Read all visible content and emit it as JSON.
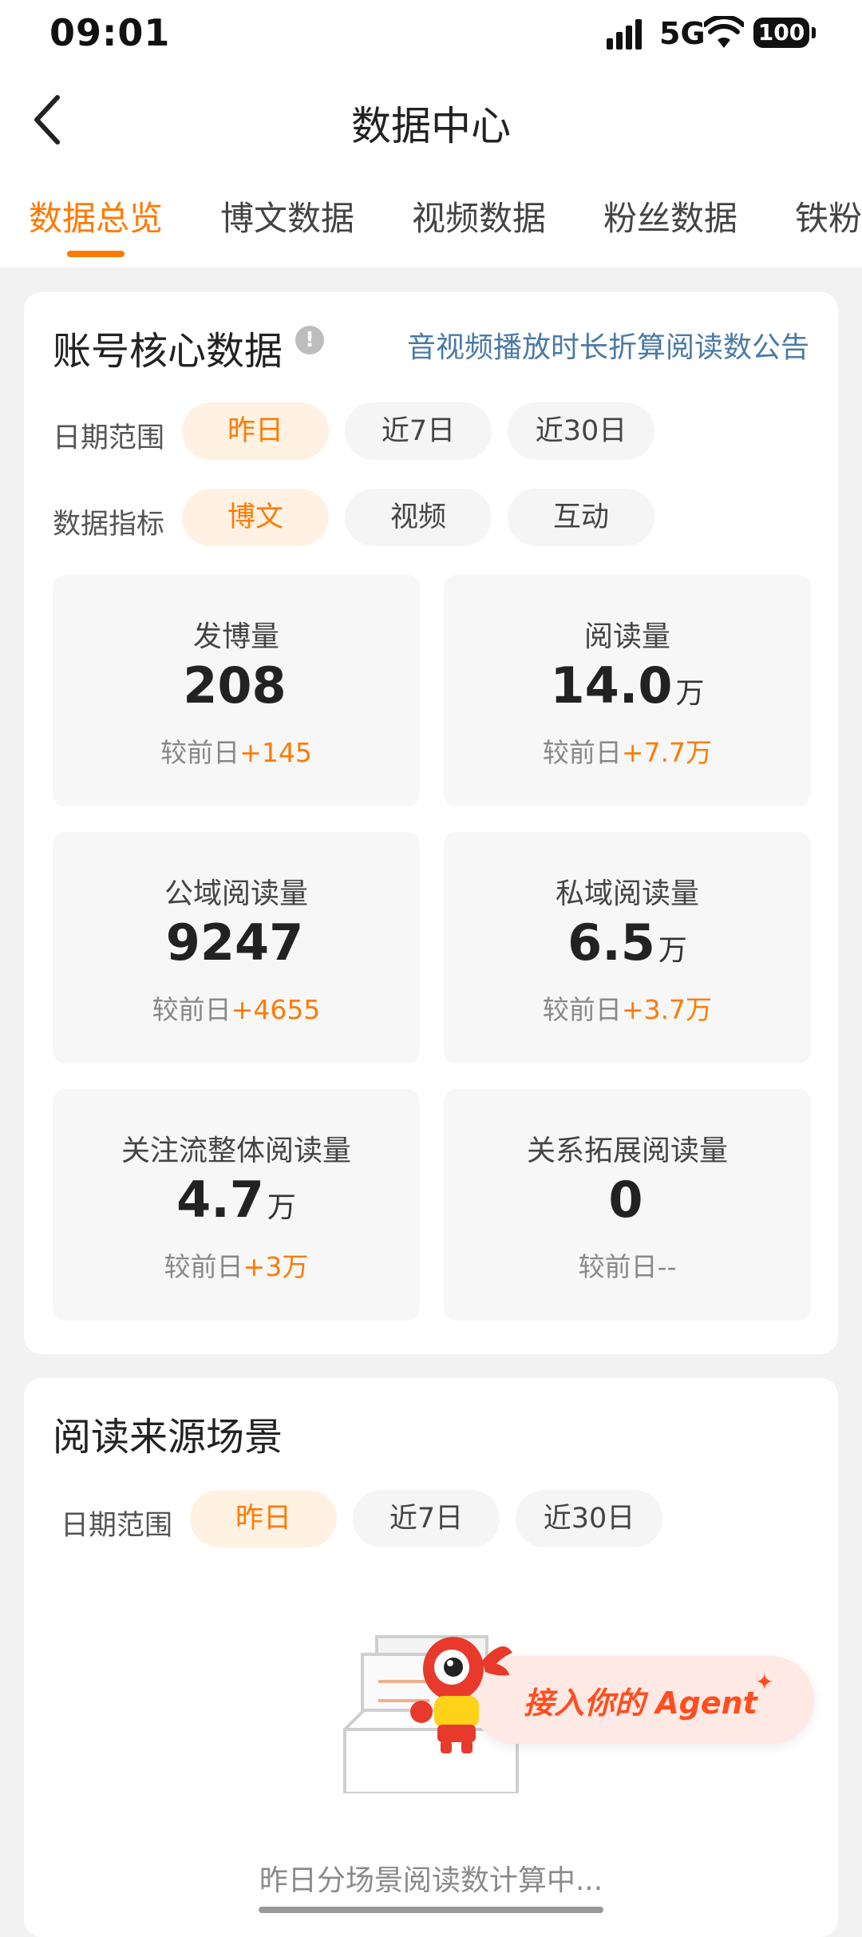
{
  "status_bar": {
    "time": "09:01",
    "network": "5G",
    "battery": "100"
  },
  "header": {
    "title": "数据中心"
  },
  "tabs": [
    {
      "label": "数据总览",
      "active": true
    },
    {
      "label": "博文数据",
      "active": false
    },
    {
      "label": "视频数据",
      "active": false
    },
    {
      "label": "粉丝数据",
      "active": false
    },
    {
      "label": "铁粉",
      "active": false
    }
  ],
  "core": {
    "title": "账号核心数据",
    "notice_link": "音视频播放时长折算阅读数公告",
    "date_label": "日期范围",
    "date_options": [
      "昨日",
      "近7日",
      "近30日"
    ],
    "date_selected": "昨日",
    "metric_label": "数据指标",
    "metric_options": [
      "博文",
      "视频",
      "互动"
    ],
    "metric_selected": "博文",
    "stats": [
      {
        "label": "发博量",
        "value": "208",
        "unit": "",
        "compare_prefix": "较前日",
        "compare_value": "+145"
      },
      {
        "label": "阅读量",
        "value": "14.0",
        "unit": "万",
        "compare_prefix": "较前日",
        "compare_value": "+7.7万"
      },
      {
        "label": "公域阅读量",
        "value": "9247",
        "unit": "",
        "compare_prefix": "较前日",
        "compare_value": "+4655"
      },
      {
        "label": "私域阅读量",
        "value": "6.5",
        "unit": "万",
        "compare_prefix": "较前日",
        "compare_value": "+3.7万"
      },
      {
        "label": "关注流整体阅读量",
        "value": "4.7",
        "unit": "万",
        "compare_prefix": "较前日",
        "compare_value": "+3万"
      },
      {
        "label": "关系拓展阅读量",
        "value": "0",
        "unit": "",
        "compare_prefix": "较前日",
        "compare_value": "--"
      }
    ]
  },
  "source": {
    "title": "阅读来源场景",
    "date_label": "日期范围",
    "date_options": [
      "昨日",
      "近7日",
      "近30日"
    ],
    "date_selected": "昨日",
    "loading_text": "昨日分场景阅读数计算中..."
  },
  "agent_banner": {
    "text": "接入你的 Agent",
    "spark": "✦"
  },
  "colors": {
    "accent": "#ff7a00",
    "link": "#4a7aa6",
    "agent": "#ff4e1f"
  }
}
